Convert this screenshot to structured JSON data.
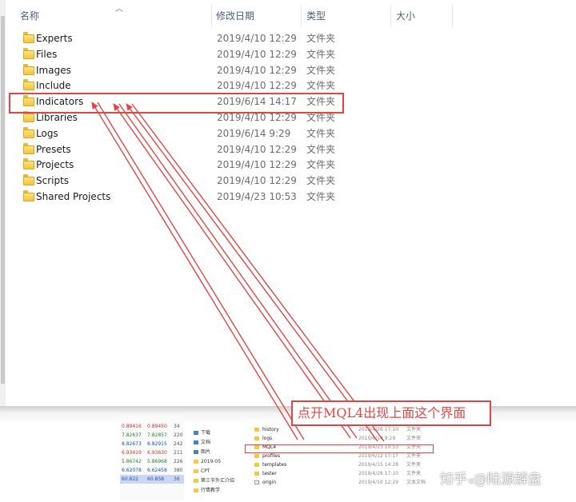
{
  "columns": {
    "name": "名称",
    "modified": "修改日期",
    "type": "类型",
    "size": "大小"
  },
  "files": [
    {
      "name": "Experts",
      "date": "2019/4/10 12:29",
      "type": "文件夹"
    },
    {
      "name": "Files",
      "date": "2019/4/10 12:29",
      "type": "文件夹"
    },
    {
      "name": "Images",
      "date": "2019/4/10 12:29",
      "type": "文件夹"
    },
    {
      "name": "Include",
      "date": "2019/4/10 12:29",
      "type": "文件夹"
    },
    {
      "name": "Indicators",
      "date": "2019/6/14 14:17",
      "type": "文件夹"
    },
    {
      "name": "Libraries",
      "date": "2019/4/10 12:29",
      "type": "文件夹"
    },
    {
      "name": "Logs",
      "date": "2019/6/14 9:29",
      "type": "文件夹"
    },
    {
      "name": "Presets",
      "date": "2019/4/10 12:29",
      "type": "文件夹"
    },
    {
      "name": "Projects",
      "date": "2019/4/10 12:29",
      "type": "文件夹"
    },
    {
      "name": "Scripts",
      "date": "2019/4/10 12:29",
      "type": "文件夹"
    },
    {
      "name": "Shared Projects",
      "date": "2019/4/23 10:53",
      "type": "文件夹"
    }
  ],
  "annotation": "点开MQL4出现上面这个界面",
  "sub_numbers": [
    [
      "0.89416",
      "0.89450",
      "34"
    ],
    [
      "7.82637",
      "7.82857",
      "220"
    ],
    [
      "8.82673",
      "8.82915",
      "242"
    ],
    [
      "6.93419",
      "6.93630",
      "211"
    ],
    [
      "5.86742",
      "5.86968",
      "226"
    ],
    [
      "6.62078",
      "6.62458",
      "380"
    ],
    [
      "60.822",
      "60.858",
      "36"
    ]
  ],
  "sub_nav": [
    {
      "label": "下载",
      "icon": "download-icon"
    },
    {
      "label": "文档",
      "icon": "document-icon"
    },
    {
      "label": "图片",
      "icon": "pictures-icon"
    },
    {
      "label": "2019-05",
      "icon": "folder-icon"
    },
    {
      "label": "CPT",
      "icon": "folder-icon"
    },
    {
      "label": "第三节外汇介绍",
      "icon": "folder-icon"
    },
    {
      "label": "行情教学",
      "icon": "folder-icon"
    }
  ],
  "sub_list": [
    {
      "name": "history",
      "date": "2019/4/26 17:10",
      "type": "文件夹"
    },
    {
      "name": "logs",
      "date": "2019/6/14 9:29",
      "type": "文件夹"
    },
    {
      "name": "MQL4",
      "date": "2019/4/23 10:53",
      "type": "文件夹"
    },
    {
      "name": "profiles",
      "date": "2019/6/12 17:17",
      "type": "文件夹"
    },
    {
      "name": "templates",
      "date": "2019/4/15 14:28",
      "type": "文件夹"
    },
    {
      "name": "tester",
      "date": "2019/4/26 17:10",
      "type": "文件夹"
    },
    {
      "name": "origin",
      "date": "2019/4/10 12:29",
      "type": "文本文档"
    }
  ],
  "watermark": {
    "brand": "知乎",
    "sep": "·K",
    "at": "@陆源解盘"
  },
  "colors": {
    "annotation_red": "#e04646",
    "folder_yellow": "#f5c443",
    "header_text": "#4c607a"
  }
}
